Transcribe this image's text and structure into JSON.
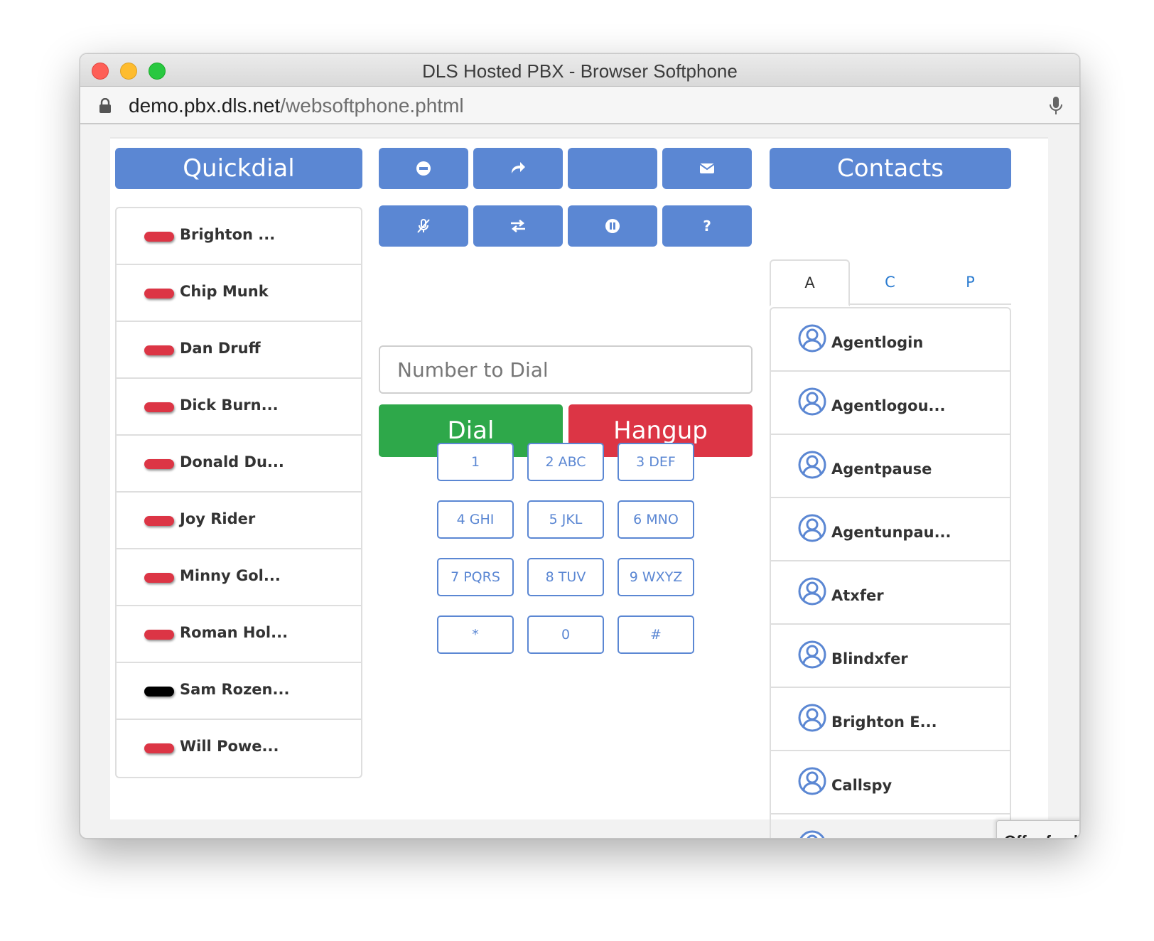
{
  "window": {
    "title": "DLS Hosted PBX - Browser Softphone",
    "url_host": "demo.pbx.dls.net",
    "url_path": "/websoftphone.phtml"
  },
  "quickdial": {
    "header": "Quickdial",
    "items": [
      {
        "label": "Brighton ...",
        "status": "red"
      },
      {
        "label": "Chip Munk",
        "status": "red"
      },
      {
        "label": "Dan Druff",
        "status": "red"
      },
      {
        "label": "Dick Burn...",
        "status": "red"
      },
      {
        "label": "Donald Du...",
        "status": "red"
      },
      {
        "label": "Joy Rider",
        "status": "red"
      },
      {
        "label": "Minny Gol...",
        "status": "red"
      },
      {
        "label": "Roman Hol...",
        "status": "red"
      },
      {
        "label": "Sam Rozen...",
        "status": "black"
      },
      {
        "label": "Will Powe...",
        "status": "red"
      }
    ]
  },
  "actions": {
    "row1": [
      "minus-circle-icon",
      "share-arrow-icon",
      "blank",
      "envelope-icon"
    ],
    "row2": [
      "mic-off-icon",
      "transfer-arrows-icon",
      "pause-icon",
      "question-icon"
    ],
    "help_label": "?"
  },
  "dialer": {
    "placeholder": "Number to Dial",
    "dial_label": "Dial",
    "hangup_label": "Hangup",
    "keys": [
      "1",
      "2 ABC",
      "3 DEF",
      "4 GHI",
      "5 JKL",
      "6 MNO",
      "7 PQRS",
      "8 TUV",
      "9 WXYZ",
      "*",
      "0",
      "#"
    ]
  },
  "contacts": {
    "header": "Contacts",
    "tabs": [
      "A",
      "C",
      "P"
    ],
    "active_tab": "A",
    "items": [
      "Agentlogin",
      "Agentlogou...",
      "Agentpause",
      "Agentunpau...",
      "Atxfer",
      "Blindxfer",
      "Brighton E...",
      "Callspy"
    ]
  },
  "feedback_label": "Offer feedback",
  "colors": {
    "primary": "#5b87d3",
    "success": "#2ea84a",
    "danger": "#dc3545"
  }
}
